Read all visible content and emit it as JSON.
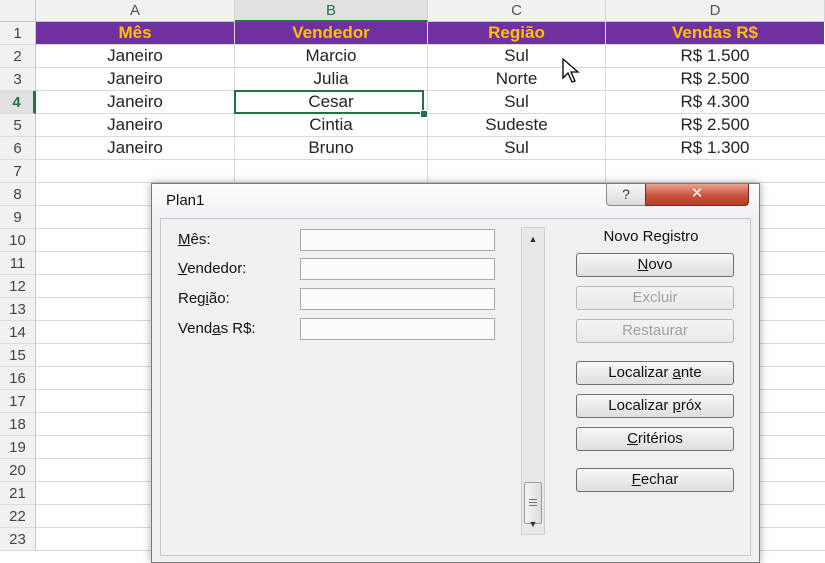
{
  "sheet": {
    "columns": [
      "A",
      "B",
      "C",
      "D"
    ],
    "rows": [
      "1",
      "2",
      "3",
      "4",
      "5",
      "6",
      "7",
      "8",
      "9",
      "10",
      "11",
      "12",
      "13",
      "14",
      "15",
      "16",
      "17",
      "18",
      "19",
      "20",
      "21",
      "22",
      "23"
    ],
    "header": [
      "Mês",
      "Vendedor",
      "Região",
      "Vendas R$"
    ],
    "data": [
      [
        "Janeiro",
        "Marcio",
        "Sul",
        "R$ 1.500"
      ],
      [
        "Janeiro",
        "Julia",
        "Norte",
        "R$ 2.500"
      ],
      [
        "Janeiro",
        "Cesar",
        "Sul",
        "R$ 4.300"
      ],
      [
        "Janeiro",
        "Cintia",
        "Sudeste",
        "R$ 2.500"
      ],
      [
        "Janeiro",
        "Bruno",
        "Sul",
        "R$ 1.300"
      ]
    ],
    "active_cell": "B4",
    "header_fill": "#7030a0",
    "header_text_color": "#ffc000",
    "selection_color": "#217346"
  },
  "dialog": {
    "title": "Plan1",
    "help_glyph": "?",
    "close_glyph": "✕",
    "fields": [
      {
        "label": "Mês:",
        "underline": 0
      },
      {
        "label": "Vendedor:",
        "underline": 0
      },
      {
        "label": "Região:",
        "underline": 3
      },
      {
        "label": "Vendas R$:",
        "underline": 4
      }
    ],
    "record_label": "Novo Registro",
    "buttons": [
      {
        "label": "Novo",
        "underline": 0,
        "enabled": true
      },
      {
        "label": "Excluir",
        "underline": -1,
        "enabled": false
      },
      {
        "label": "Restaurar",
        "underline": -1,
        "enabled": false
      },
      {
        "label": "Localizar ante",
        "underline": 10,
        "enabled": true
      },
      {
        "label": "Localizar próx",
        "underline": 10,
        "enabled": true
      },
      {
        "label": "Critérios",
        "underline": 0,
        "enabled": true
      },
      {
        "label": "Fechar",
        "underline": 0,
        "enabled": true
      }
    ]
  }
}
